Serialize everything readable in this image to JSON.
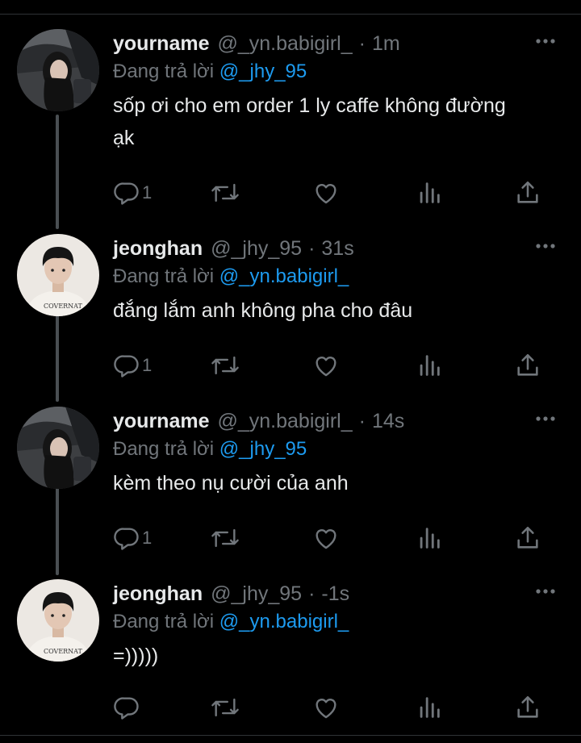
{
  "colors": {
    "background": "#000000",
    "primary_text": "#e7e9ea",
    "secondary_text": "#71767b",
    "accent": "#1d9bf0",
    "thread_line": "#4a4f53"
  },
  "reply_prefix": "Đang trả lời",
  "icons": [
    "more-icon",
    "reply-icon",
    "retweet-icon",
    "like-icon",
    "views-icon",
    "share-icon"
  ],
  "tweets": [
    {
      "name": "yourname",
      "handle": "@_yn.babigirl_",
      "dot": "·",
      "time": "1m",
      "replying_to": "@_jhy_95",
      "text": "sốp ơi cho em order 1 ly caffe không đường ạk",
      "reply_count": "1"
    },
    {
      "name": "jeonghan",
      "handle": "@_jhy_95",
      "dot": "·",
      "time": "31s",
      "replying_to": "@_yn.babigirl_",
      "text": "đắng lắm anh không pha cho đâu",
      "reply_count": "1"
    },
    {
      "name": "yourname",
      "handle": "@_yn.babigirl_",
      "dot": "·",
      "time": "14s",
      "replying_to": "@_jhy_95",
      "text": "kèm theo nụ cười của anh",
      "reply_count": "1"
    },
    {
      "name": "jeonghan",
      "handle": "@_jhy_95",
      "dot": "·",
      "time": "-1s",
      "replying_to": "@_yn.babigirl_",
      "text": "=)))))",
      "reply_count": ""
    }
  ]
}
